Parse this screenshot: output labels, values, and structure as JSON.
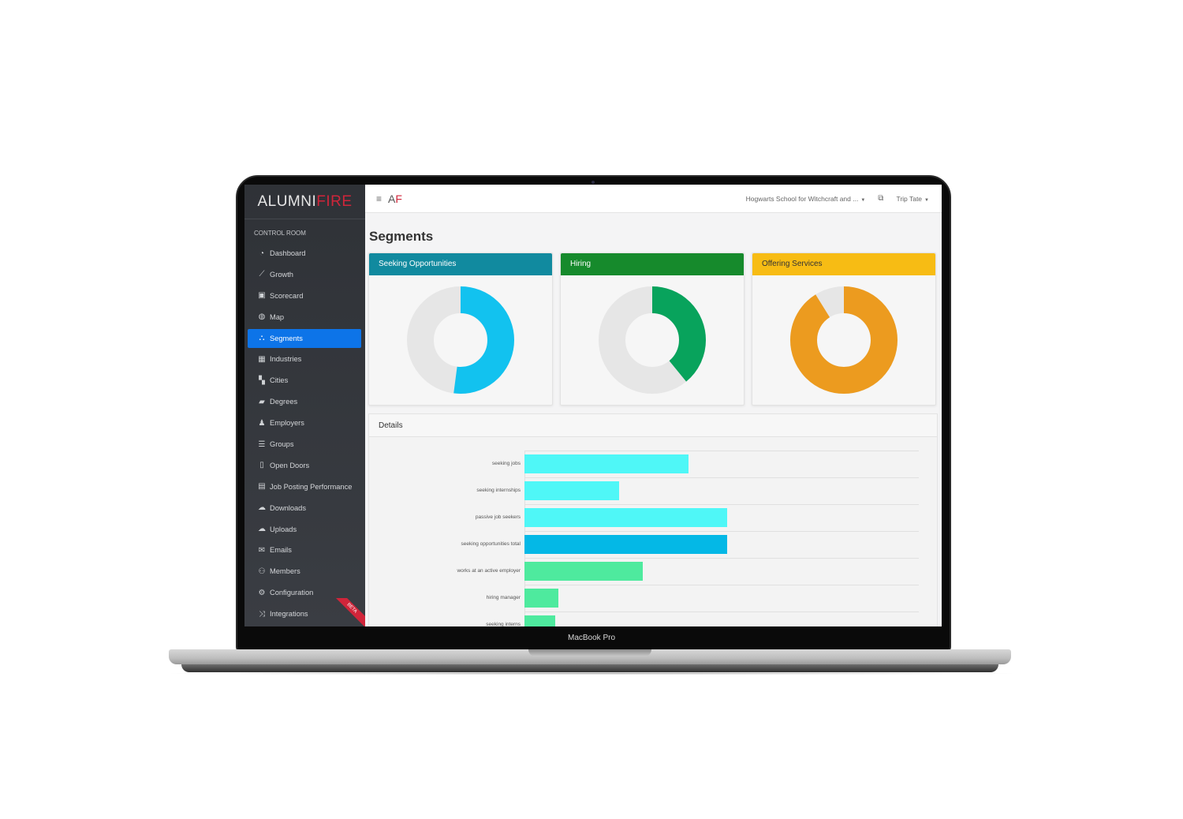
{
  "device": {
    "model_label": "MacBook Pro"
  },
  "sidebar": {
    "brand": {
      "part1": "ALUMNI",
      "part2": "FIRE"
    },
    "section_label": "CONTROL ROOM",
    "items": [
      {
        "label": "Dashboard",
        "icon": "tachometer-icon",
        "glyph": "◔",
        "active": false
      },
      {
        "label": "Growth",
        "icon": "line-chart-icon",
        "glyph": "⟋",
        "active": false
      },
      {
        "label": "Scorecard",
        "icon": "presentation-icon",
        "glyph": "▣",
        "active": false
      },
      {
        "label": "Map",
        "icon": "globe-icon",
        "glyph": "◍",
        "active": false
      },
      {
        "label": "Segments",
        "icon": "sitemap-icon",
        "glyph": "⛬",
        "active": true
      },
      {
        "label": "Industries",
        "icon": "buildings-icon",
        "glyph": "▦",
        "active": false
      },
      {
        "label": "Cities",
        "icon": "map-icon",
        "glyph": "▚",
        "active": false
      },
      {
        "label": "Degrees",
        "icon": "graduation-cap-icon",
        "glyph": "▰",
        "active": false
      },
      {
        "label": "Employers",
        "icon": "user-tie-icon",
        "glyph": "♟",
        "active": false
      },
      {
        "label": "Groups",
        "icon": "list-icon",
        "glyph": "☰",
        "active": false
      },
      {
        "label": "Open Doors",
        "icon": "door-open-icon",
        "glyph": "▯",
        "active": false
      },
      {
        "label": "Job Posting Performance",
        "icon": "id-card-icon",
        "glyph": "▤",
        "active": false
      },
      {
        "label": "Downloads",
        "icon": "cloud-download-icon",
        "glyph": "☁",
        "active": false
      },
      {
        "label": "Uploads",
        "icon": "cloud-upload-icon",
        "glyph": "☁",
        "active": false
      },
      {
        "label": "Emails",
        "icon": "envelope-icon",
        "glyph": "✉",
        "active": false
      },
      {
        "label": "Members",
        "icon": "users-icon",
        "glyph": "⚇",
        "active": false
      },
      {
        "label": "Configuration",
        "icon": "cogs-icon",
        "glyph": "⚙",
        "active": false
      },
      {
        "label": "Integrations",
        "icon": "random-icon",
        "glyph": "⤨",
        "active": false,
        "badge": "BETA"
      }
    ]
  },
  "topbar": {
    "menu_icon": "≡",
    "logo": {
      "part1": "A",
      "part2": "F"
    },
    "school_selector": "Hogwarts School for Witchcraft and ...",
    "user_menu": "Trip Tate"
  },
  "main": {
    "page_title": "Segments",
    "cards": [
      {
        "title": "Seeking Opportunities",
        "header_color": "#118a9f",
        "fill_color": "#12c2ef",
        "percent": 52
      },
      {
        "title": "Hiring",
        "header_color": "#168a2c",
        "fill_color": "#08a35c",
        "percent": 39
      },
      {
        "title": "Offering Services",
        "header_color": "#f7bc14",
        "fill_color": "#ec9b1f",
        "percent": 91
      }
    ],
    "details_title": "Details"
  },
  "chart_data": {
    "type": "bar",
    "orientation": "horizontal",
    "title": "Details",
    "categories": [
      "seeking jobs",
      "seeking internships",
      "passive job seekers",
      "seeking opportunities total",
      "works at an active employer",
      "hiring manager",
      "seeking interns"
    ],
    "values": [
      208,
      120,
      257,
      257,
      150,
      43,
      39
    ],
    "colors": [
      "#4ff7f7",
      "#4ff7f7",
      "#4ff7f7",
      "#04b8e6",
      "#4eea9e",
      "#4eea9e",
      "#4eea9e"
    ],
    "xlim": [
      0,
      500
    ],
    "grid": true,
    "xlabel": "",
    "ylabel": ""
  }
}
